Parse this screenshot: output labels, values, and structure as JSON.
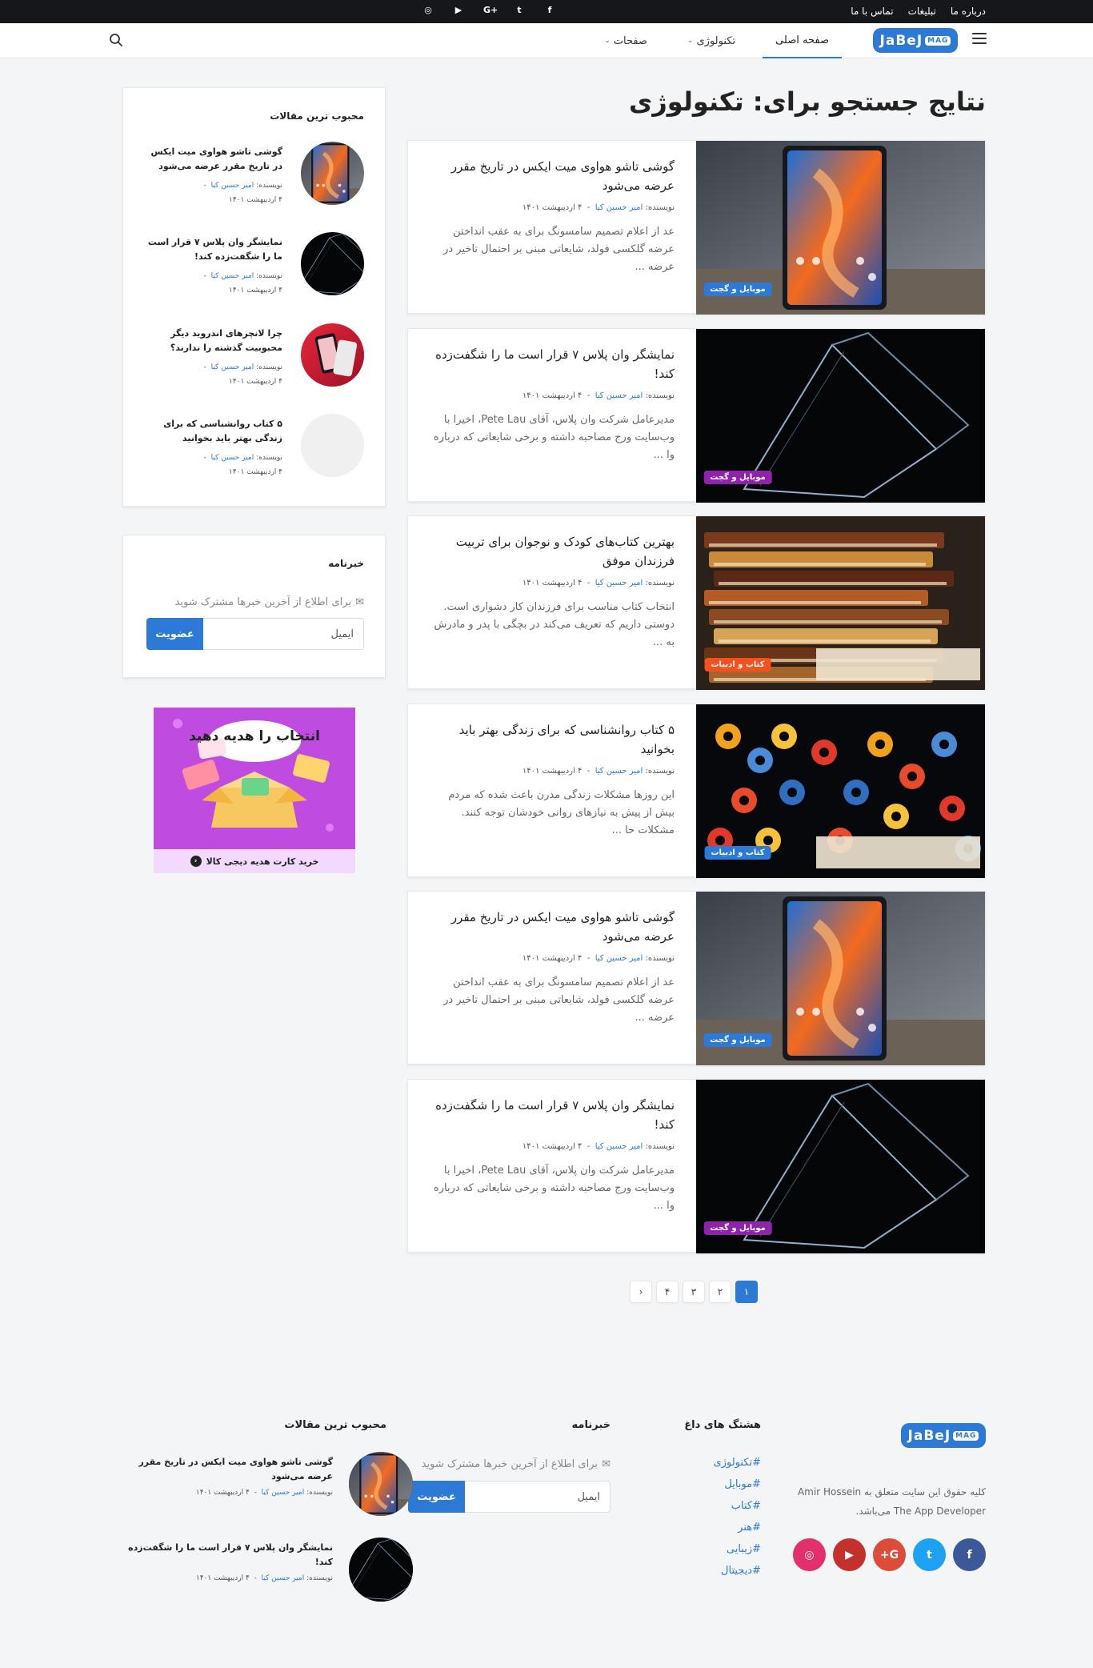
{
  "topbar": {
    "links": [
      "درباره ما",
      "تبلیغات",
      "تماس با ما"
    ],
    "social_icons": [
      "facebook-icon",
      "twitter-icon",
      "google-plus-icon",
      "youtube-icon",
      "instagram-icon"
    ],
    "social_glyphs": [
      "f",
      "t",
      "G+",
      "▶",
      "◎"
    ]
  },
  "header": {
    "logo_text": "JaBeJ",
    "logo_badge": "MAG",
    "nav": [
      {
        "label": "صفحه اصلی",
        "active": true,
        "has_dropdown": false
      },
      {
        "label": "تکنولوژی",
        "active": false,
        "has_dropdown": true
      },
      {
        "label": "صفحات",
        "active": false,
        "has_dropdown": true
      }
    ]
  },
  "page_title": "نتایج جستجو برای: تکنولوژی",
  "posts": [
    {
      "title": "گوشی تاشو هواوی میت ایکس در تاریخ مقرر عرضه می‌شود",
      "author_label": "نویسنده:",
      "author": "امیر حسین کیا",
      "date": "۴ اردیبهشت ۱۴۰۱",
      "excerpt": "عد از اعلام تصمیم سامسونگ برای به عقب انداختن عرضه گلکسی فولد، شایعاتی مبنی بر احتمال تاخیر در عرضه ...",
      "category": "موبایل و گجت",
      "category_color": "#2c7ad6",
      "image": "phone"
    },
    {
      "title": "نمایشگر وان پلاس ۷ قرار است ما را شگفت‌زده کند!",
      "author_label": "نویسنده:",
      "author": "امیر حسین کیا",
      "date": "۴ اردیبهشت ۱۴۰۱",
      "excerpt": "مدیرعامل شرکت وان پلاس، آقای Pete Lau، اخیرا با وب‌سایت ورج مصاحبه داشته و برخی شایعاتی که درباره وا ...",
      "category": "موبایل و گجت",
      "category_color": "#8e24aa",
      "image": "dark"
    },
    {
      "title": "بهترین کتاب‌های کودک و نوجوان برای تربیت فرزندان موفق",
      "author_label": "نویسنده:",
      "author": "امیر حسین کیا",
      "date": "۴ اردیبهشت ۱۴۰۱",
      "excerpt": "انتخاب کتاب مناسب برای فرزندان کار دشواری است. دوستی داریم که تعریف می‌کند در بچگی با پدر و مادرش به ...",
      "category": "کتاب و ادبیات",
      "category_color": "#f4511e",
      "image": "books"
    },
    {
      "title": "۵ کتاب روانشناسی که برای زندگی بهتر باید بخوانید",
      "author_label": "نویسنده:",
      "author": "امیر حسین کیا",
      "date": "۴ اردیبهشت ۱۴۰۱",
      "excerpt": "این روزها مشکلات زندگی مدرن باعث شده که مردم بیش از پیش به نیازهای روانی خودشان توجه کنند. مشکلات حا ...",
      "category": "کتاب و ادبیات",
      "category_color": "#2c7ad6",
      "image": "gears"
    },
    {
      "title": "گوشی تاشو هواوی میت ایکس در تاریخ مقرر عرضه می‌شود",
      "author_label": "نویسنده:",
      "author": "امیر حسین کیا",
      "date": "۴ اردیبهشت ۱۴۰۱",
      "excerpt": "عد از اعلام تصمیم سامسونگ برای به عقب انداختن عرضه گلکسی فولد، شایعاتی مبنی بر احتمال تاخیر در عرضه ...",
      "category": "موبایل و گجت",
      "category_color": "#2c7ad6",
      "image": "phone"
    },
    {
      "title": "نمایشگر وان پلاس ۷ قرار است ما را شگفت‌زده کند!",
      "author_label": "نویسنده:",
      "author": "امیر حسین کیا",
      "date": "۴ اردیبهشت ۱۴۰۱",
      "excerpt": "مدیرعامل شرکت وان پلاس، آقای Pete Lau، اخیرا با وب‌سایت ورج مصاحبه داشته و برخی شایعاتی که درباره وا ...",
      "category": "موبایل و گجت",
      "category_color": "#8e24aa",
      "image": "dark"
    }
  ],
  "pagination": {
    "pages": [
      "۱",
      "۲",
      "۳",
      "۴"
    ],
    "current": "۱",
    "next": "›"
  },
  "sidebar": {
    "popular": {
      "title": "محبوب ترین مقالات",
      "items": [
        {
          "title": "گوشی تاشو هواوی میت ایکس در تاریخ مقرر عرضه می‌شود",
          "author_label": "نویسنده:",
          "author": "امیر حسین کیا",
          "date": "۴ اردیبهشت ۱۴۰۱",
          "image": "phone"
        },
        {
          "title": "نمایشگر وان پلاس ۷ قرار است ما را شگفت‌زده کند!",
          "author_label": "نویسنده:",
          "author": "امیر حسین کیا",
          "date": "۴ اردیبهشت ۱۴۰۱",
          "image": "dark"
        },
        {
          "title": "چرا لانچرهای اندروید دیگر محبوبیت گذشته را ندارند؟",
          "author_label": "نویسنده:",
          "author": "امیر حسین کیا",
          "date": "۴ اردیبهشت ۱۴۰۱",
          "image": "red"
        },
        {
          "title": "۵ کتاب روانشناسی که برای زندگی بهتر باید بخوانید",
          "author_label": "نویسنده:",
          "author": "امیر حسین کیا",
          "date": "۴ اردیبهشت ۱۴۰۱",
          "image": "empty"
        }
      ]
    },
    "newsletter": {
      "title": "خبرنامه",
      "desc": "برای اطلاع از آخرین خبرها مشترک شوید",
      "placeholder": "ایمیل",
      "button": "عضویت"
    },
    "ad": {
      "headline": "انتخاب را هدیه دهید",
      "caption": "خرید کارت هدیه دیجی کالا"
    }
  },
  "footer": {
    "logo_text": "JaBeJ",
    "logo_badge": "MAG",
    "copyright": "کلیه حقوق این سایت متعلق به Amir Hossein The App Developer می‌باشد.",
    "hashtags_title": "هشتگ های داغ",
    "hashtags": [
      "#تکنولوژی",
      "#موبایل",
      "#کتاب",
      "#هنر",
      "#زیبایی",
      "#دیجیتال"
    ],
    "newsletter_title": "خبرنامه",
    "newsletter_desc": "برای اطلاع از آخرین خبرها مشترک شوید",
    "newsletter_placeholder": "ایمیل",
    "newsletter_button": "عضویت",
    "popular_title": "محبوب ترین مقالات",
    "popular": [
      {
        "title": "گوشی تاشو هواوی میت ایکس در تاریخ مقرر عرضه می‌شود",
        "author_label": "نویسنده:",
        "author": "امیر حسین کیا",
        "date": "۴ اردیبهشت ۱۴۰۱",
        "image": "phone"
      },
      {
        "title": "نمایشگر وان پلاس ۷ قرار است ما را شگفت‌زده کند!",
        "author_label": "نویسنده:",
        "author": "امیر حسین کیا",
        "date": "۴ اردیبهشت ۱۴۰۱",
        "image": "dark"
      }
    ],
    "social": [
      {
        "name": "facebook-icon",
        "glyph": "f",
        "color": "#3b5998"
      },
      {
        "name": "twitter-icon",
        "glyph": "t",
        "color": "#1da1f2"
      },
      {
        "name": "google-plus-icon",
        "glyph": "G+",
        "color": "#dd4b39"
      },
      {
        "name": "youtube-icon",
        "glyph": "▶",
        "color": "#c4302b"
      },
      {
        "name": "instagram-icon",
        "glyph": "◎",
        "color": "#e1306c"
      }
    ]
  }
}
